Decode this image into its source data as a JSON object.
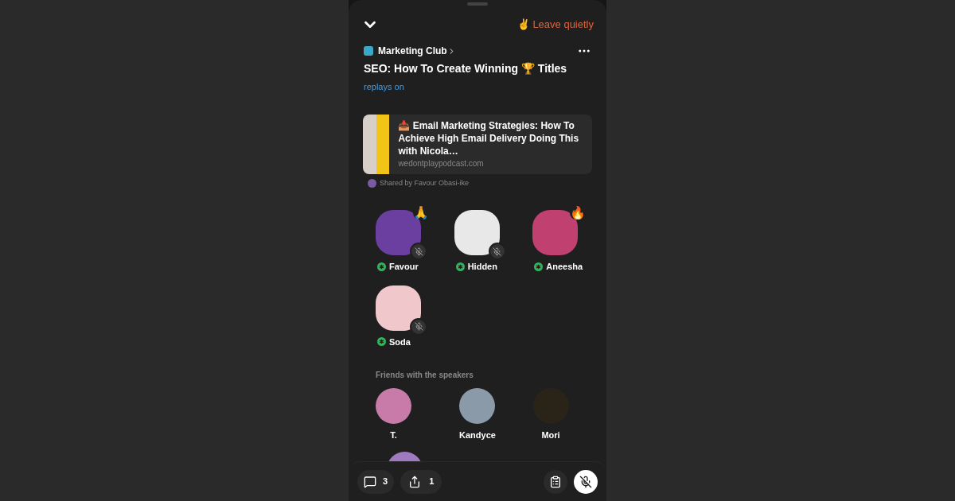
{
  "header": {
    "leave_label": "✌️ Leave quietly"
  },
  "room": {
    "club": "Marketing Club",
    "title": "SEO: How To Create Winning 🏆 Titles",
    "replays": "replays on"
  },
  "link_card": {
    "title": "📥 Email Marketing Strategies: How To Achieve High Email Delivery Doing This with Nicola…",
    "domain": "wedontplaypodcast.com",
    "shared_by": "Shared by Favour Obasi-ike"
  },
  "speakers": [
    {
      "name": "Favour",
      "reaction": "🙏",
      "moderator": true,
      "muted": true,
      "color": "#6b3fa0"
    },
    {
      "name": "Hidden",
      "moderator": true,
      "muted": true,
      "color": "#e8e8e8"
    },
    {
      "name": "Aneesha",
      "reaction": "🔥",
      "moderator": true,
      "muted": false,
      "color": "#c04070"
    },
    {
      "name": "Soda",
      "moderator": true,
      "muted": true,
      "color": "#f0c8cc"
    }
  ],
  "friends": {
    "title": "Friends with the speakers",
    "people": [
      {
        "name": "T.",
        "color": "#c87aa8"
      },
      {
        "name": "Kandyce",
        "color": "#8a9aa8"
      },
      {
        "name": "Mori",
        "color": "#2a2418"
      },
      {
        "color": "#a07ac0"
      }
    ]
  },
  "toolbar": {
    "chat_count": "3",
    "share_count": "1",
    "mic_muted": true
  }
}
